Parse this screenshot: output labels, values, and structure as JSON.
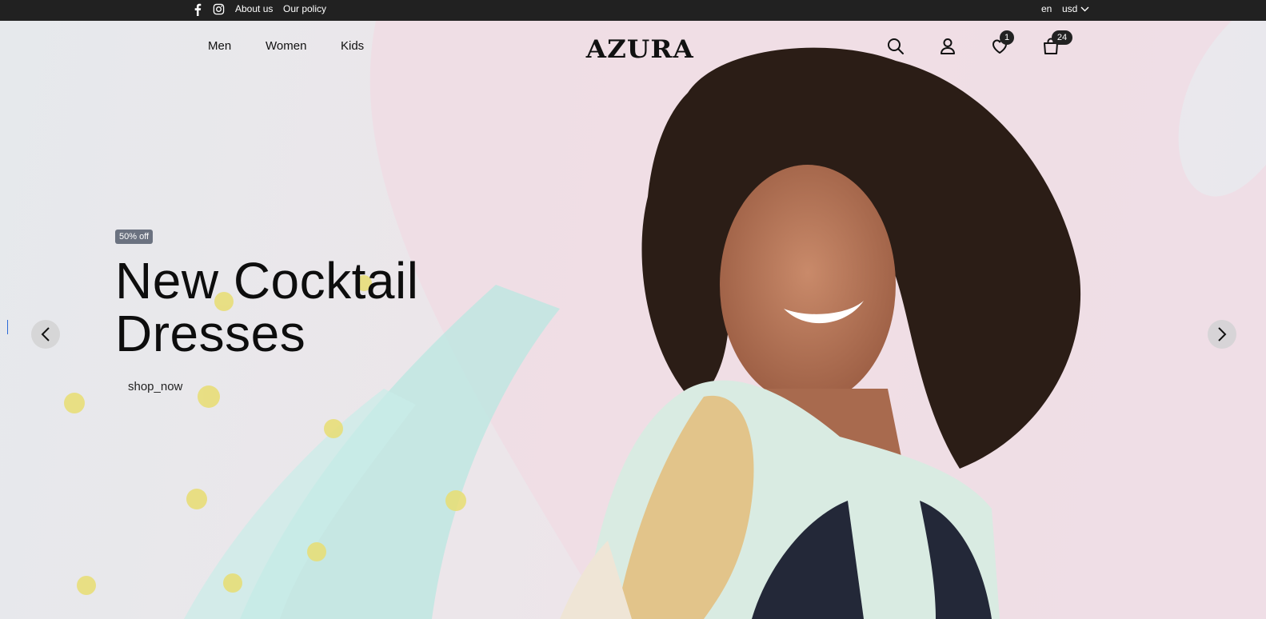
{
  "topbar": {
    "about_label": "About us",
    "policy_label": "Our policy",
    "language": "en",
    "currency": "usd",
    "icons": [
      "facebook-icon",
      "instagram-icon",
      "chevron-down-icon"
    ]
  },
  "header": {
    "nav": [
      {
        "label": "Men"
      },
      {
        "label": "Women"
      },
      {
        "label": "Kids"
      }
    ],
    "logo": "AZURA",
    "wishlist_count": "1",
    "cart_count": "24",
    "icons": [
      "search-icon",
      "user-icon",
      "heart-icon",
      "bag-icon"
    ]
  },
  "hero": {
    "badge": "50% off",
    "headline_line1": "New Cocktail",
    "headline_line2": "Dresses",
    "cta": "shop_now",
    "icons": [
      "chevron-left-icon",
      "chevron-right-icon"
    ]
  },
  "colors": {
    "topbar_bg": "#212121",
    "badge_bg": "#6b7280",
    "text": "#0d0d0d"
  }
}
